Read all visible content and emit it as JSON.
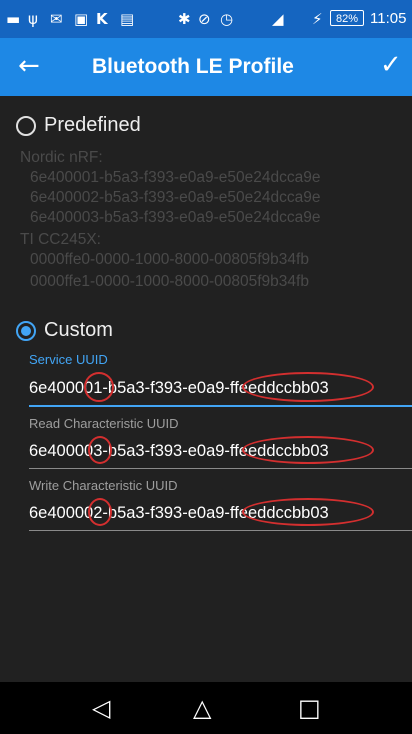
{
  "status_bar": {
    "icons": [
      "notification-icon",
      "usb-icon",
      "sms-icon",
      "image-icon",
      "k-icon",
      "bbm-icon",
      "bluetooth-icon",
      "block-icon",
      "alarm-icon",
      "signal-icon",
      "charging-icon"
    ],
    "battery": "82%",
    "time": "11:05"
  },
  "app_bar": {
    "title": "Bluetooth LE Profile"
  },
  "predefined": {
    "label": "Predefined",
    "lines": [
      "Nordic nRF:",
      "6e400001-b5a3-f393-e0a9-e50e24dcca9e",
      "6e400002-b5a3-f393-e0a9-e50e24dcca9e",
      "6e400003-b5a3-f393-e0a9-e50e24dcca9e",
      "TI CC245X:",
      "0000ffe0-0000-1000-8000-00805f9b34fb",
      "0000ffe1-0000-1000-8000-00805f9b34fb"
    ]
  },
  "custom": {
    "label": "Custom",
    "fields": [
      {
        "label": "Service UUID",
        "value": "6e400001-b5a3-f393-e0a9-ffeeddccbb03"
      },
      {
        "label": "Read Characteristic UUID",
        "value": "6e400003-b5a3-f393-e0a9-ffeeddccbb03"
      },
      {
        "label": "Write Characteristic UUID",
        "value": "6e400002-b5a3-f393-e0a9-ffeeddccbb03"
      }
    ]
  },
  "colors": {
    "accent": "#42a5f5",
    "app_bar": "#1e88e5",
    "status_bar": "#1565c0",
    "highlight": "#d32f2f"
  },
  "nav_bar": {
    "icons": [
      "back-icon",
      "home-icon",
      "recents-icon"
    ]
  }
}
